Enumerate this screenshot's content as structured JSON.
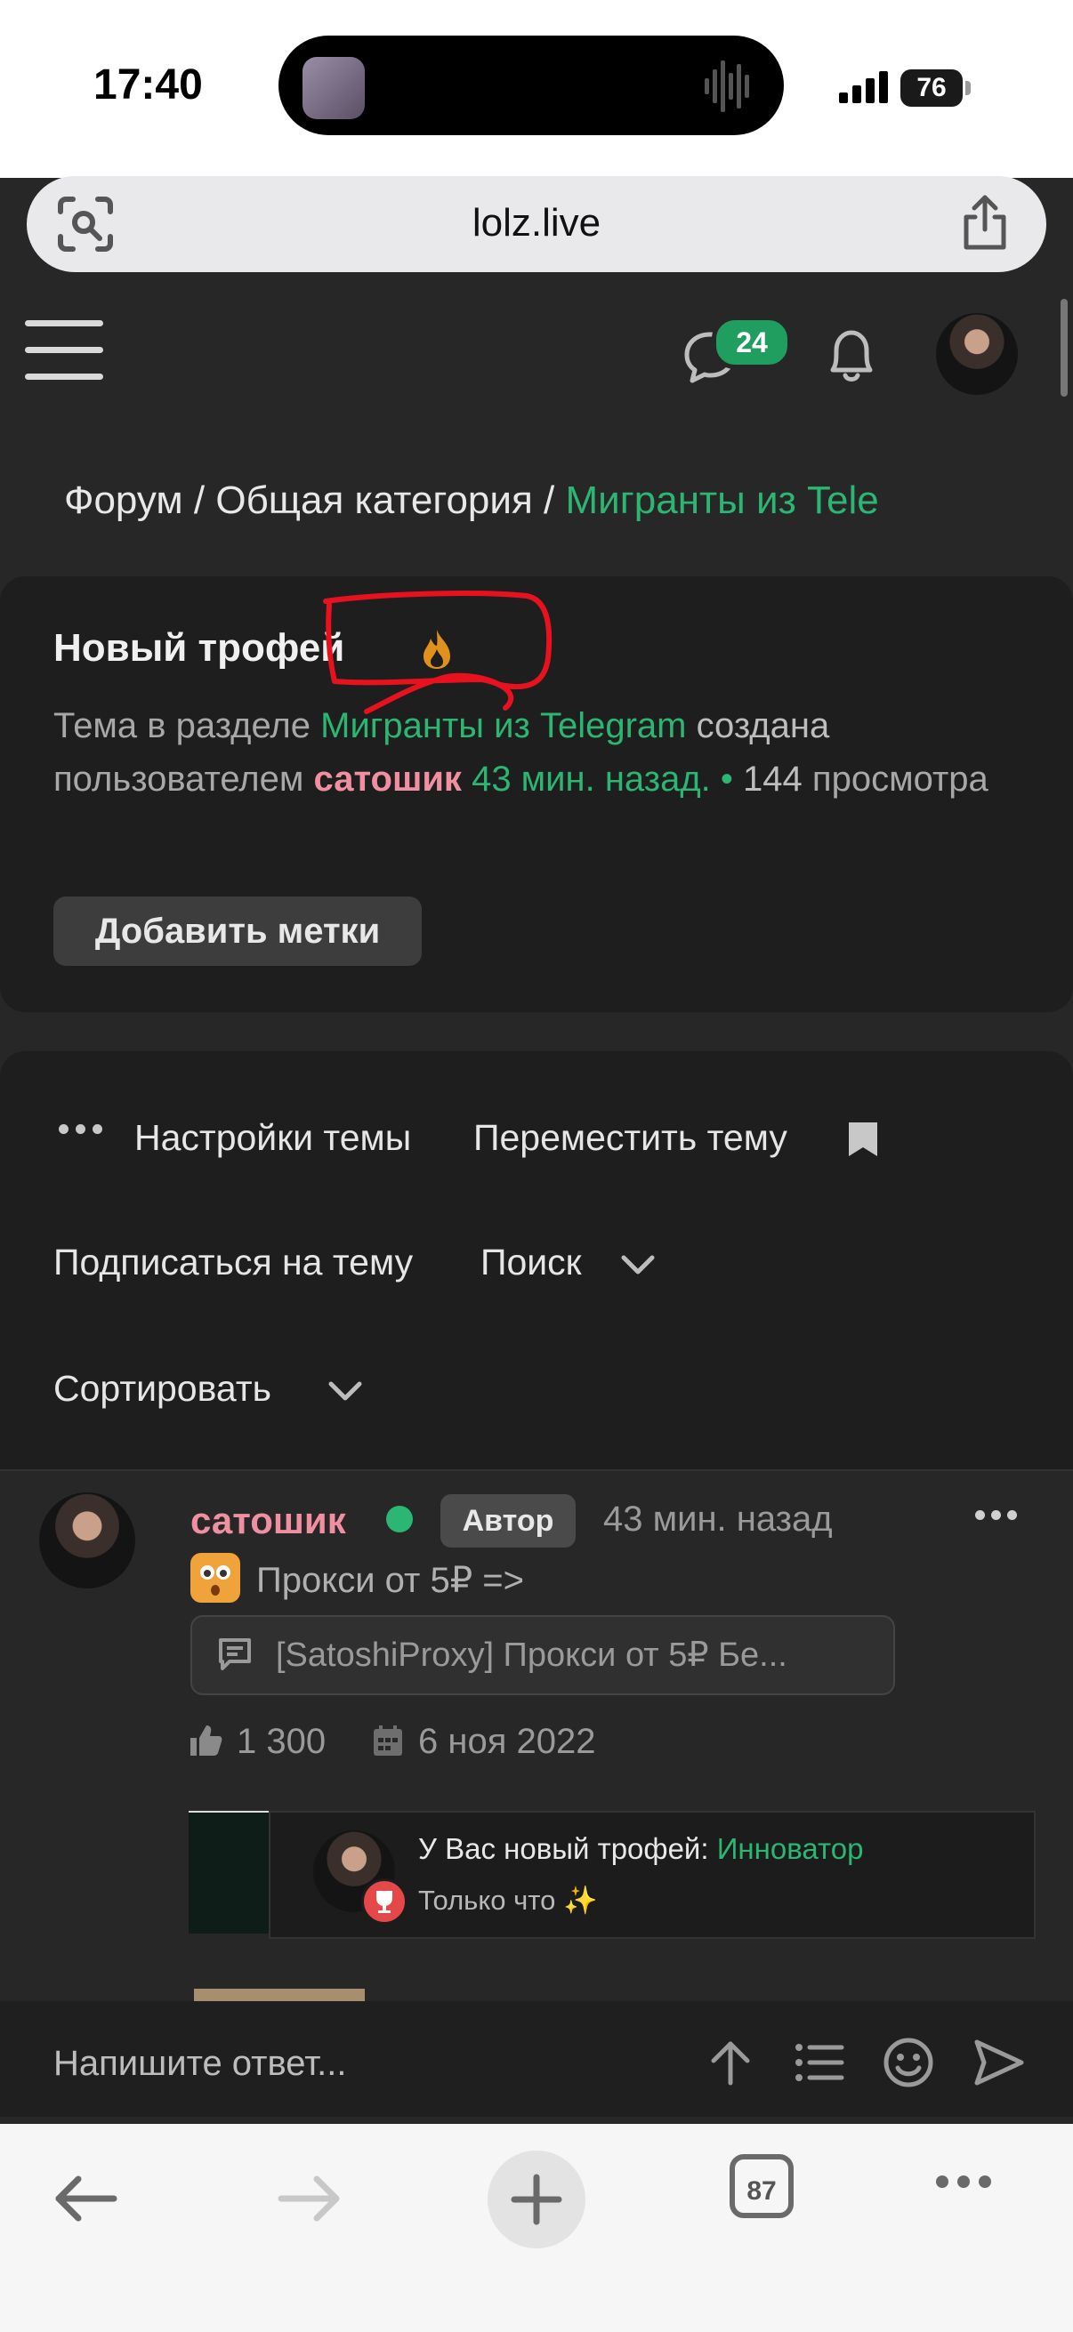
{
  "status": {
    "time": "17:40",
    "battery": "76"
  },
  "browser": {
    "url": "lolz.live",
    "tabs_count": "87"
  },
  "header": {
    "messages_badge": "24"
  },
  "breadcrumb": {
    "forum": "Форум",
    "sep": "/",
    "category": "Общая категория",
    "section": "Мигранты из Tele"
  },
  "thread": {
    "title": "Новый трофей",
    "desc_prefix": "Тема в разделе",
    "desc_section": "Мигранты из Telegram",
    "desc_created": "создана",
    "desc_by": "пользователем",
    "author": "сатошик",
    "created_ago": "43 мин. назад.",
    "bullet": "•",
    "views": "144",
    "views_label": "просмотра",
    "add_tags": "Добавить метки"
  },
  "options": {
    "settings": "Настройки темы",
    "move": "Переместить тему",
    "subscribe": "Подписаться на тему",
    "search": "Поиск",
    "sort": "Сортировать"
  },
  "post": {
    "author": "сатошик",
    "badge": "Автор",
    "time": "43 мин. назад",
    "title": "Прокси от 5₽ =>",
    "preview": "[SatoshiProxy] Прокси от 5₽ Бе...",
    "likes": "1 300",
    "date": "6 ноя 2022"
  },
  "toast": {
    "prefix": "У Вас новый трофей:",
    "trophy": "Инноватор",
    "time": "Только что",
    "sparkle": "✨"
  },
  "reply": {
    "placeholder": "Напишите ответ..."
  },
  "colors": {
    "accent_green": "#2bb673",
    "author_pink": "#f08fa2",
    "annotation_red": "#e8121e"
  }
}
